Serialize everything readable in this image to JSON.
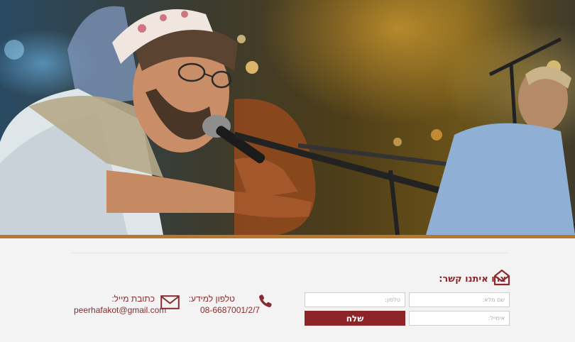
{
  "hero": {
    "accent_color": "#b8772c"
  },
  "contact_form": {
    "title": "צרו איתנו קשר:",
    "icon": "envelope-open-icon",
    "name_placeholder": "שם מלא:",
    "phone_placeholder": "טלפון:",
    "email_placeholder": "אימייל:",
    "send_label": "שלח",
    "button_color": "#8c2428"
  },
  "contact_info": {
    "phone": {
      "icon": "phone-icon",
      "label": "טלפון למידע:",
      "value": "08-6687001/2/7"
    },
    "email": {
      "icon": "envelope-icon",
      "label": "כתובת מייל:",
      "value": "peerhafakot@gmail.com"
    },
    "text_color": "#8a2a2e"
  }
}
